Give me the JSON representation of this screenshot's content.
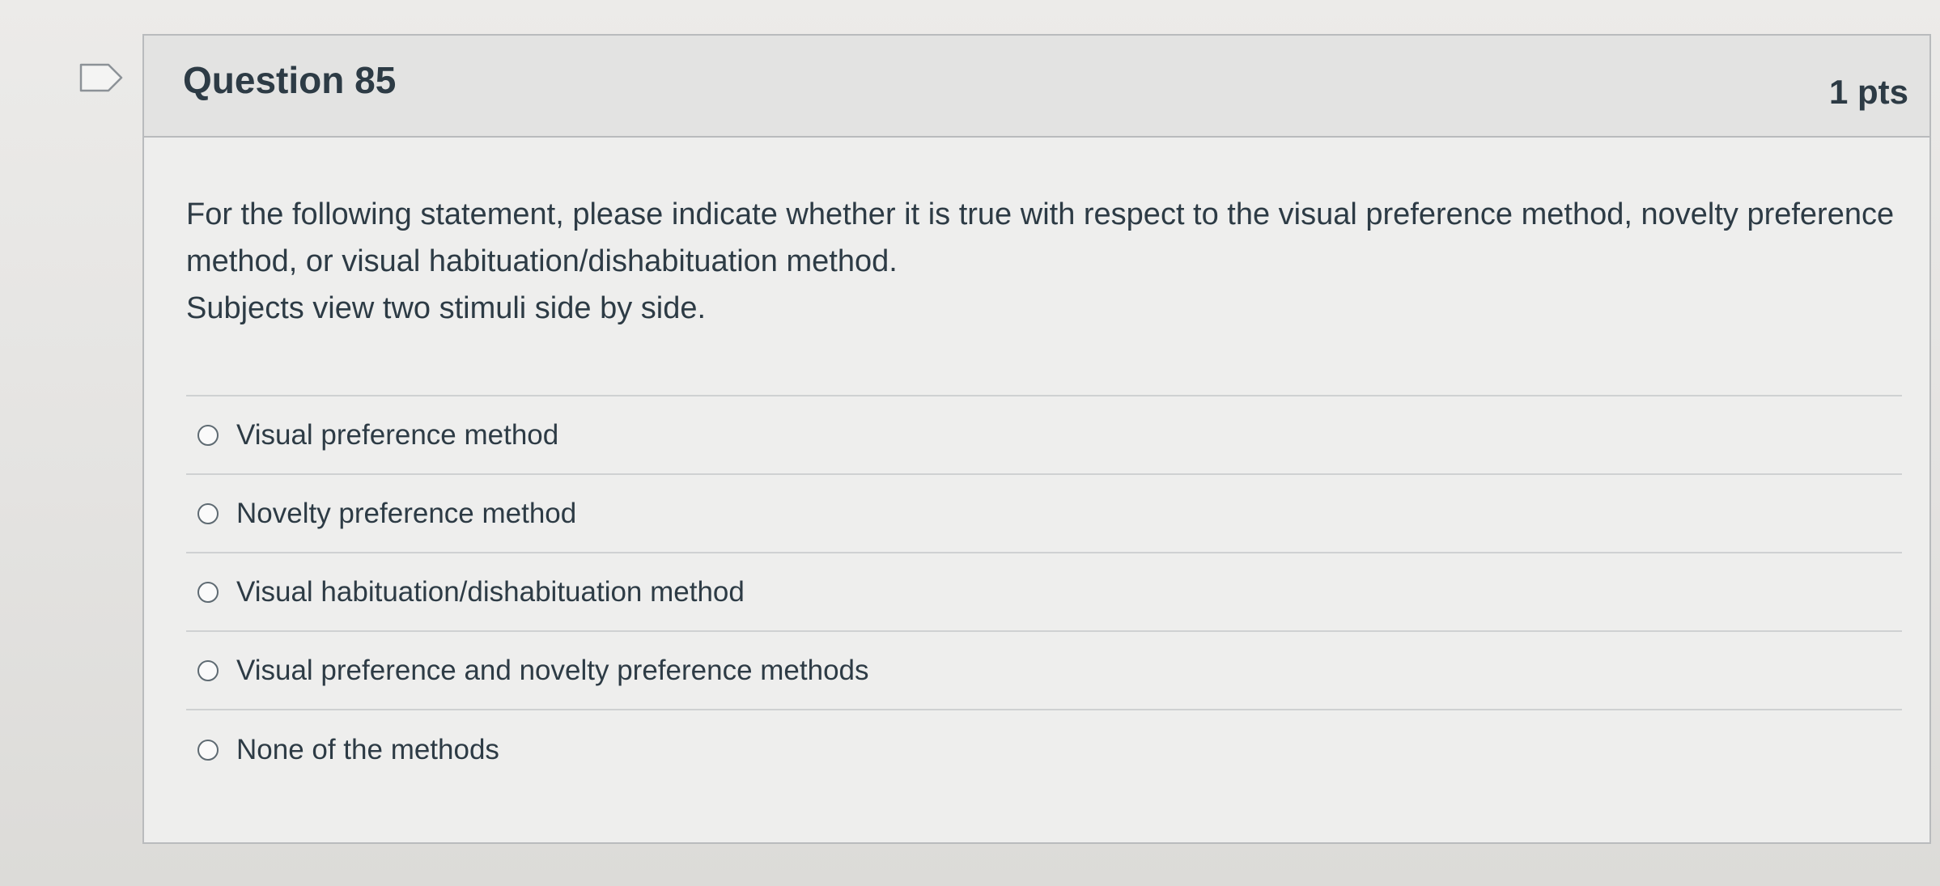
{
  "question": {
    "title": "Question 85",
    "points": "1 pts",
    "flag_icon": "bookmark-flag-icon",
    "text_lines": [
      "For the following statement, please indicate whether it is true with respect to the visual preference method, novelty preference method, or visual habituation/dishabituation method.",
      "Subjects view two stimuli side by side."
    ],
    "answers": [
      {
        "label": "Visual preference method",
        "selected": false
      },
      {
        "label": "Novelty preference method",
        "selected": false
      },
      {
        "label": "Visual habituation/dishabituation method",
        "selected": false
      },
      {
        "label": "Visual preference and novelty preference methods",
        "selected": false
      },
      {
        "label": "None of the methods",
        "selected": false
      }
    ]
  },
  "colors": {
    "text": "#2d3b45",
    "header_bg": "#e3e3e2",
    "border": "#b9bbbd"
  }
}
